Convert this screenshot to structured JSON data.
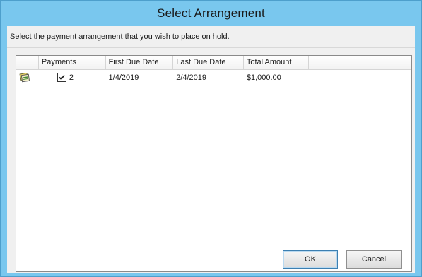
{
  "window": {
    "title": "Select Arrangement"
  },
  "instruction": "Select the payment arrangement that you wish to place on hold.",
  "grid": {
    "columns": [
      "",
      "Payments",
      "First Due Date",
      "Last Due Date",
      "Total Amount",
      ""
    ],
    "rows": [
      {
        "icon": "payment-arrangement-icon",
        "payments": "2",
        "payments_checked": true,
        "first_due_date": "1/4/2019",
        "last_due_date": "2/4/2019",
        "total_amount": "$1,000.00"
      }
    ]
  },
  "buttons": {
    "ok": "OK",
    "cancel": "Cancel"
  },
  "colors": {
    "titlebar": "#79c7ee",
    "client": "#f0f0f0",
    "ok_border": "#3c7fb1"
  }
}
